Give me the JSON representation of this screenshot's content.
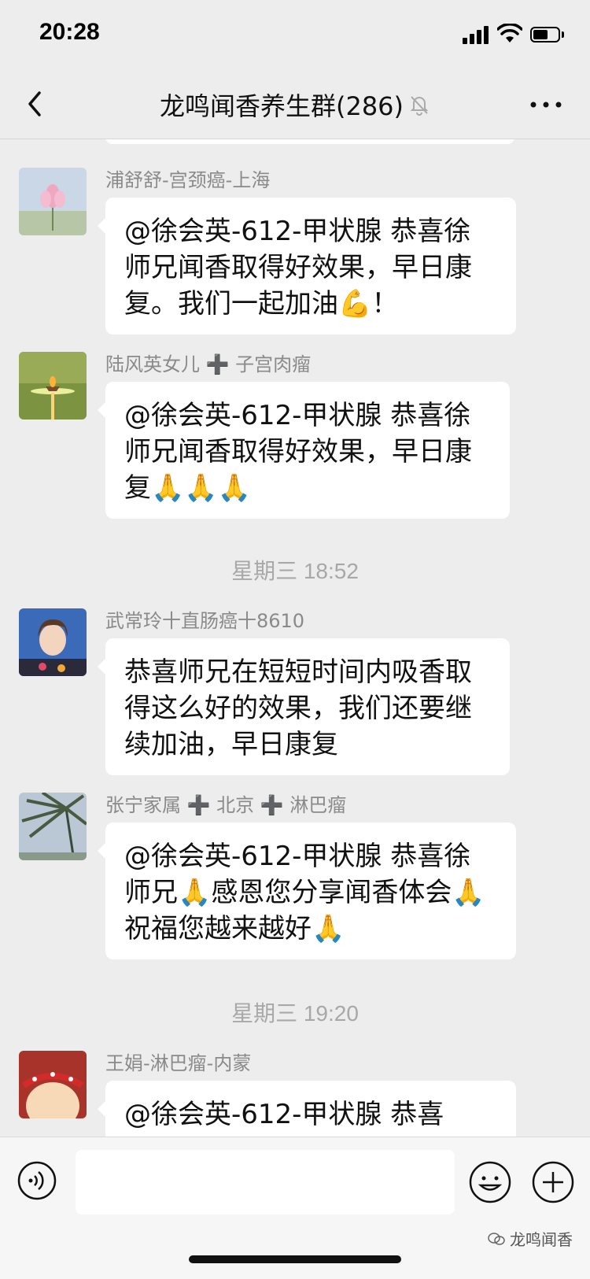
{
  "status_bar": {
    "time": "20:28"
  },
  "header": {
    "title": "龙鸣闻香养生群(286)"
  },
  "messages": [
    {
      "sender": "浦舒舒-宫颈癌-上海",
      "text": "@徐会英-612-甲状腺 恭喜徐师兄闻香取得好效果，早日康复。我们一起加油💪！"
    },
    {
      "sender": "陆风英女儿 ➕ 子宫肉瘤",
      "text": "@徐会英-612-甲状腺 恭喜徐师兄闻香取得好效果，早日康复🙏🙏🙏"
    },
    {
      "sender": "武常玲十直肠癌十8610",
      "text": "恭喜师兄在短短时间内吸香取得这么好的效果，我们还要继续加油，早日康复"
    },
    {
      "sender": "张宁家属 ➕ 北京 ➕ 淋巴瘤",
      "text": "@徐会英-612-甲状腺 恭喜徐师兄🙏感恩您分享闻香体会🙏祝福您越来越好🙏"
    },
    {
      "sender": "王娟-淋巴瘤-内蒙",
      "text": "@徐会英-612-甲状腺 恭喜"
    }
  ],
  "timestamps": [
    "星期三 18:52",
    "星期三 19:20"
  ],
  "input": {
    "placeholder": ""
  },
  "watermark": "龙鸣闻香"
}
